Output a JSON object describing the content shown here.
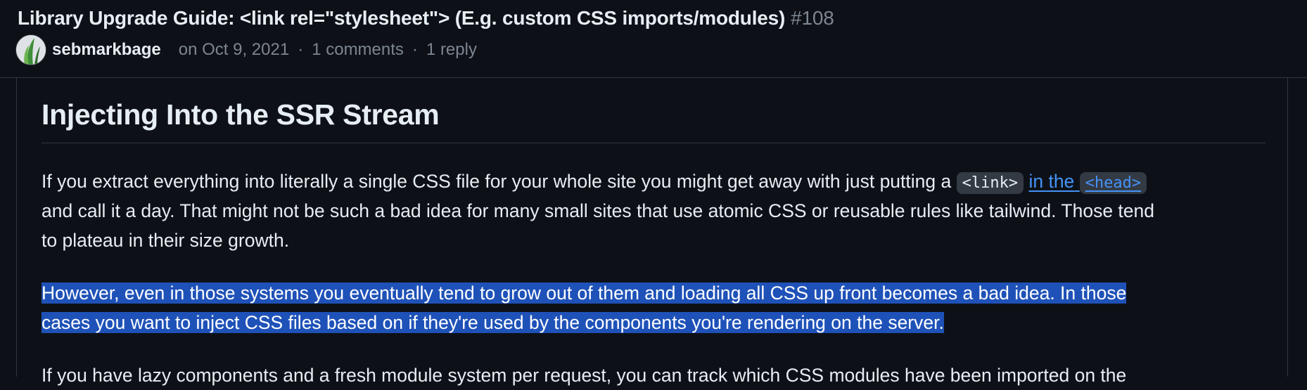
{
  "header": {
    "title": "Library Upgrade Guide: <link rel=\"stylesheet\"> (E.g. custom CSS imports/modules)",
    "number": "#108",
    "author": "sebmarkbage",
    "date": "on Oct 9, 2021",
    "comments": "1 comments",
    "separator": "·",
    "replies": "1 reply"
  },
  "article": {
    "heading": "Injecting Into the SSR Stream",
    "p1": {
      "line1_text": "If you extract everything into literally a single CSS file for your whole site you might get away with just putting a ",
      "line1_code": "<link>",
      "line1_link_text": "in the",
      "line1_link_code": "<head>",
      "line2": "and call it a day. That might not be such a bad idea for many small sites that use atomic CSS or reusable rules like tailwind. Those tend",
      "line3": "to plateau in their size growth."
    },
    "p2": {
      "line1": "However, even in those systems you eventually tend to grow out of them and loading all CSS up front becomes a bad idea. In those",
      "line2": "cases you want to inject CSS files based on if they're used by the components you're rendering on the server."
    },
    "p3": {
      "line1": "If you have lazy components and a fresh module system per request, you can track which CSS modules have been imported on the"
    }
  },
  "colors": {
    "background": "#0d1117",
    "text": "#e6edf3",
    "muted": "#7d8590",
    "link": "#4493f8",
    "selection": "#1f52b8"
  }
}
